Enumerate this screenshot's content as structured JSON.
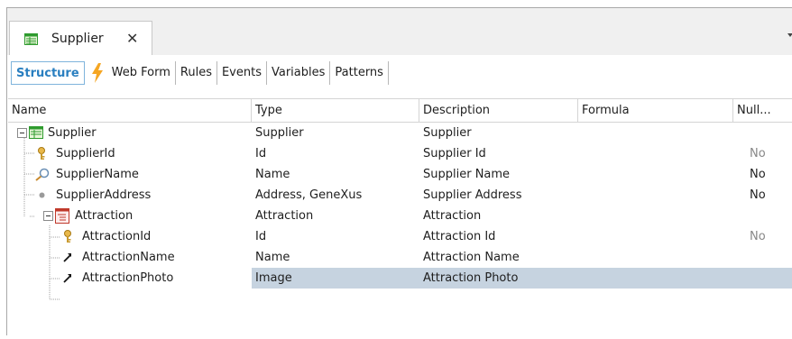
{
  "tab": {
    "title": "Supplier",
    "close": "✕"
  },
  "subtabs": [
    "Structure",
    "Web Form",
    "Rules",
    "Events",
    "Variables",
    "Patterns"
  ],
  "columns": [
    "Name",
    "Type",
    "Description",
    "Formula",
    "Null..."
  ],
  "rows": [
    {
      "name": "Supplier",
      "type": "Supplier",
      "description": "Supplier",
      "formula": "",
      "nullable": ""
    },
    {
      "name": "SupplierId",
      "type": "Id",
      "description": "Supplier Id",
      "formula": "",
      "nullable": "No"
    },
    {
      "name": "SupplierName",
      "type": "Name",
      "description": "Supplier Name",
      "formula": "",
      "nullable": "No"
    },
    {
      "name": "SupplierAddress",
      "type": "Address, GeneXus",
      "description": "Supplier Address",
      "formula": "",
      "nullable": "No"
    },
    {
      "name": "Attraction",
      "type": "Attraction",
      "description": "Attraction",
      "formula": "",
      "nullable": ""
    },
    {
      "name": "AttractionId",
      "type": "Id",
      "description": "Attraction Id",
      "formula": "",
      "nullable": "No"
    },
    {
      "name": "AttractionName",
      "type": "Name",
      "description": "Attraction Name",
      "formula": "",
      "nullable": ""
    },
    {
      "name": "AttractionPhoto",
      "type": "Image",
      "description": "Attraction Photo",
      "formula": "",
      "nullable": ""
    }
  ],
  "icons": {
    "tab": "transaction-icon",
    "toggle": "collapse-icon",
    "key": "key-icon",
    "description": "description-attribute-icon",
    "attribute": "attribute-icon",
    "level": "level-icon",
    "lightning": "lightning-icon"
  },
  "colors": {
    "accent": "#2a7fc0",
    "selection": "#c6d3e0",
    "lightning": "#f5a623"
  }
}
